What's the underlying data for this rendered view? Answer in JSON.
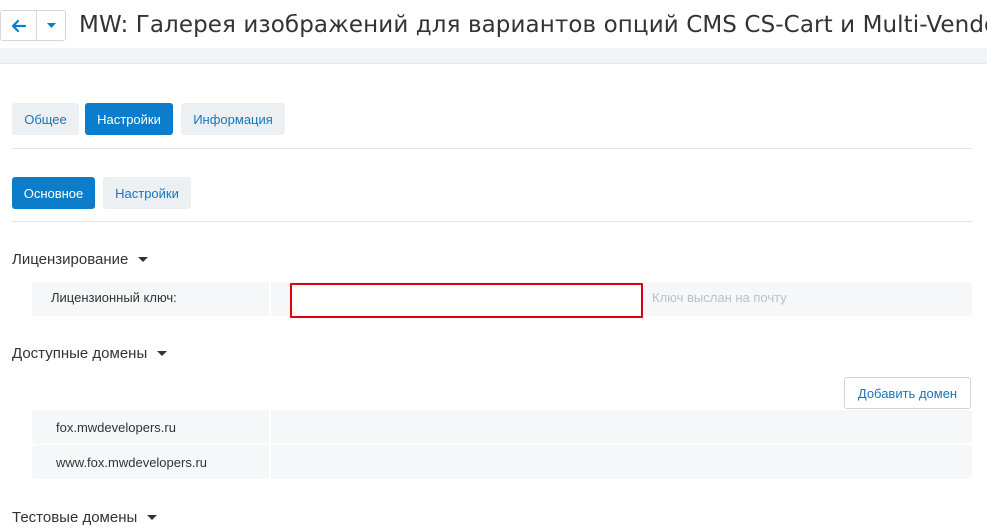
{
  "header": {
    "title": "MW: Галерея изображений для вариантов опций CMS CS-Cart и Multi-Vendor",
    "back_icon": "arrow-left-icon",
    "dropdown_icon": "caret-down-icon"
  },
  "tabs": [
    {
      "label": "Общее",
      "active": false
    },
    {
      "label": "Настройки",
      "active": true
    },
    {
      "label": "Информация",
      "active": false
    }
  ],
  "subtabs": [
    {
      "label": "Основное",
      "active": true
    },
    {
      "label": "Настройки",
      "active": false
    }
  ],
  "licensing": {
    "title": "Лицензирование",
    "key_label": "Лицензионный ключ:",
    "key_value": "",
    "hint": "Ключ выслан на почту"
  },
  "domains": {
    "title": "Доступные домены",
    "add_button": "Добавить домен",
    "items": [
      "fox.mwdevelopers.ru",
      "www.fox.mwdevelopers.ru"
    ]
  },
  "test_domains": {
    "title": "Тестовые домены"
  },
  "colors": {
    "accent": "#0b7dcb",
    "link": "#1a74b8",
    "error_border": "#e0000b"
  }
}
